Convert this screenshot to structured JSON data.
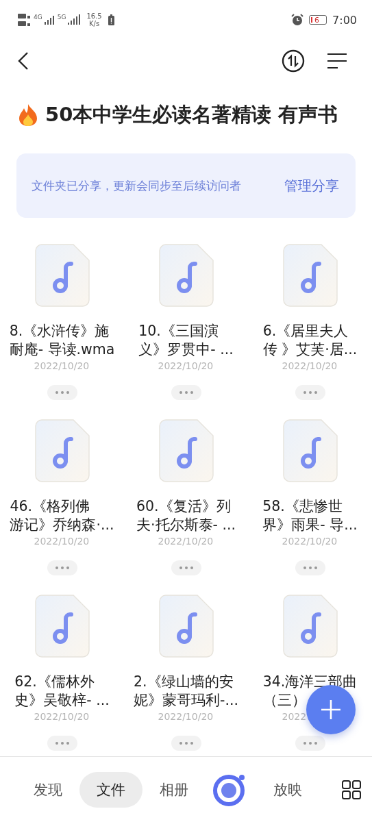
{
  "status_bar": {
    "network_1": "4G",
    "network_2": "5G",
    "speed": "16.5",
    "speed_unit": "K/s",
    "battery": "6",
    "time": "7:00"
  },
  "title": "50本中学生必读名著精读 有声书",
  "share_banner": {
    "message": "文件夹已分享，更新会同步至后续访问者",
    "action": "管理分享"
  },
  "files": [
    {
      "name": [
        "8.《水浒传》施",
        "耐庵- 导读.wma"
      ],
      "date": "2022/10/20"
    },
    {
      "name": [
        "10.《三国演",
        "义》罗贯中- ..."
      ],
      "date": "2022/10/20"
    },
    {
      "name": [
        "6.《居里夫人",
        "传 》艾芙·居..."
      ],
      "date": "2022/10/20"
    },
    {
      "name": [
        "46.《格列佛",
        "游记》乔纳森·..."
      ],
      "date": "2022/10/20"
    },
    {
      "name": [
        "60.《复活》列",
        "夫·托尔斯泰- ..."
      ],
      "date": "2022/10/20"
    },
    {
      "name": [
        "58.《悲惨世",
        "界》雨果- 导..."
      ],
      "date": "2022/10/20"
    },
    {
      "name": [
        "62.《儒林外",
        "史》吴敬梓- ..."
      ],
      "date": "2022/10/20"
    },
    {
      "name": [
        "2.《绿山墙的安",
        "妮》蒙哥玛利-..."
      ],
      "date": "2022/10/20"
    },
    {
      "name": [
        "34.海洋三部曲",
        "（三）"
      ],
      "date": "2022"
    }
  ],
  "tabs": [
    {
      "label": "发现",
      "selected": false
    },
    {
      "label": "文件",
      "selected": true
    },
    {
      "label": "相册",
      "selected": false
    },
    {
      "kind": "logo",
      "selected": false
    },
    {
      "label": "放映",
      "selected": false
    }
  ]
}
